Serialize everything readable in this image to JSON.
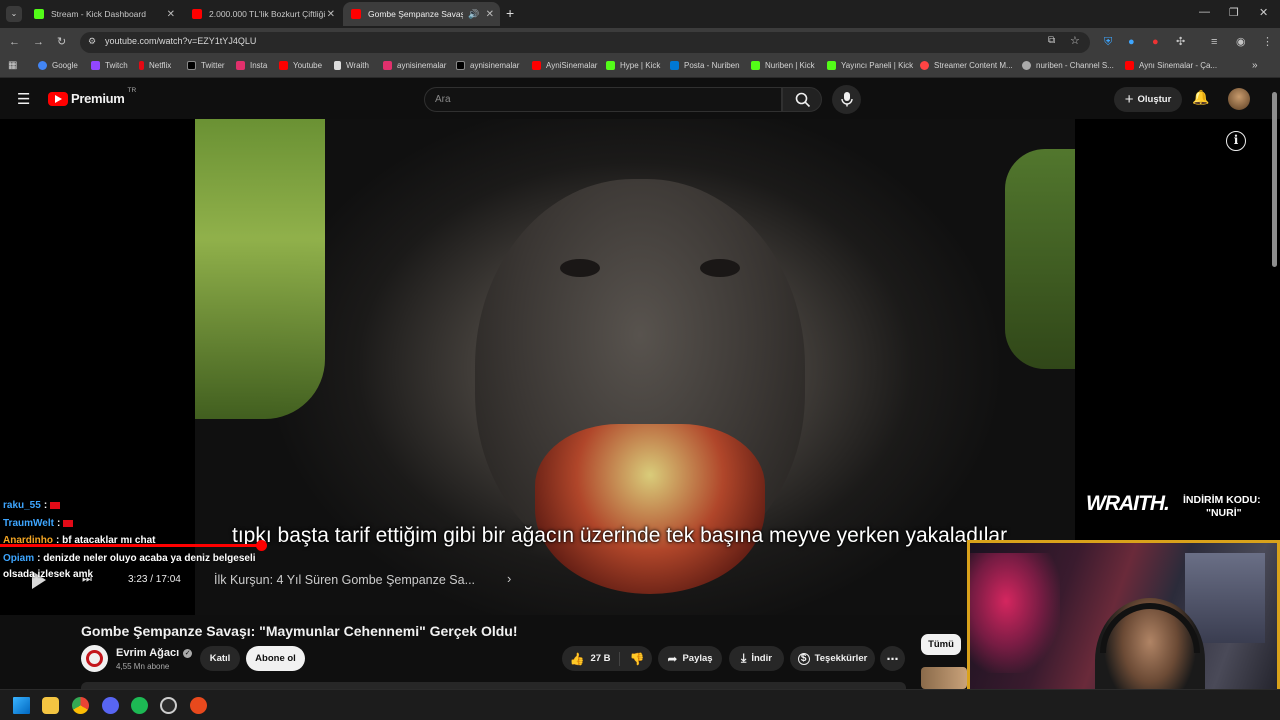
{
  "browser": {
    "tabs": [
      {
        "title": "Stream - Kick Dashboard",
        "color": "#53fc18"
      },
      {
        "title": "2.000.000 TL'lik Bozkurt Çiftliği",
        "color": "#ff0000"
      },
      {
        "title": "Gombe Şempanze Savaşı: \"",
        "color": "#ff0000"
      }
    ],
    "url": "youtube.com/watch?v=EZY1tYJ4QLU",
    "bookmarks": [
      {
        "label": "Google",
        "color": "#4285f4"
      },
      {
        "label": "Twitch",
        "color": "#9146ff"
      },
      {
        "label": "Netflix",
        "color": "#e50914"
      },
      {
        "label": "Twitter",
        "color": "#000000"
      },
      {
        "label": "Insta",
        "color": "#e1306c"
      },
      {
        "label": "Youtube",
        "color": "#ff0000"
      },
      {
        "label": "Wraith",
        "color": "#dddddd"
      },
      {
        "label": "aynisinemalar",
        "color": "#e1306c"
      },
      {
        "label": "aynisinemalar",
        "color": "#000000"
      },
      {
        "label": "AyniSinemalar",
        "color": "#ff0000"
      },
      {
        "label": "Hype | Kick",
        "color": "#53fc18"
      },
      {
        "label": "Posta - Nuriben",
        "color": "#0078d4"
      },
      {
        "label": "Nuriben | Kick",
        "color": "#53fc18"
      },
      {
        "label": "Yayıncı Paneli | Kick",
        "color": "#53fc18"
      },
      {
        "label": "Streamer Content M...",
        "color": "#ff4444"
      },
      {
        "label": "nuriben - Channel S...",
        "color": "#aaaaaa"
      },
      {
        "label": "Aynı Sinemalar - Ça...",
        "color": "#ff0000"
      }
    ]
  },
  "youtube": {
    "logo": "Premium",
    "region": "TR",
    "search_placeholder": "Ara",
    "create_label": "Oluştur"
  },
  "player": {
    "subtitle": "tıpkı başta tarif ettiğim gibi bir ağacın üzerinde tek başına meyve yerken yakaladılar",
    "time": "3:23 / 17:04",
    "chapter": "İlk Kurşun: 4 Yıl Süren Gombe Şempanze Sa...",
    "progress_fraction": 0.197
  },
  "chat": [
    {
      "user": "raku_55",
      "user_color": "#3ea6ff",
      "message": ""
    },
    {
      "user": "TraumWelt",
      "user_color": "#3ea6ff",
      "message": ""
    },
    {
      "user": "Anardinho",
      "user_color": "#f5a623",
      "message": "bf atacaklar mı chat"
    },
    {
      "user": "Opiam",
      "user_color": "#3ea6ff",
      "message": "denizde neler oluyo acaba ya deniz belgeseli"
    },
    {
      "user": "",
      "user_color": "#ffffff",
      "message": "olsada izlesek amk"
    }
  ],
  "sponsor": {
    "brand": "WRAITH.",
    "line1": "İNDİRİM KODU:",
    "line2": "\"NURİ\""
  },
  "video": {
    "title": "Gombe Şempanze Savaşı: \"Maymunlar Cehennemi\" Gerçek Oldu!",
    "channel": "Evrim Ağacı",
    "subscribers": "4,55 Mn abone",
    "join": "Katıl",
    "subscribe": "Abone ol",
    "likes": "27 B",
    "share": "Paylaş",
    "download": "İndir",
    "thanks": "Teşekkürler",
    "filter_all": "Tümü"
  }
}
